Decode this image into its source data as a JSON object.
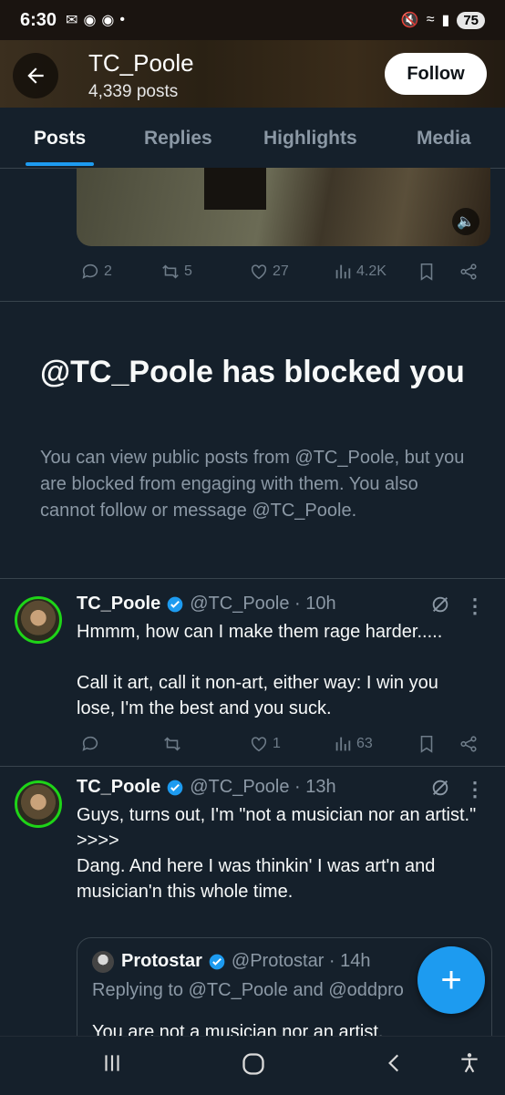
{
  "status_bar": {
    "time": "6:30",
    "battery": "75"
  },
  "header": {
    "title": "TC_Poole",
    "subtitle": "4,339 posts",
    "follow_label": "Follow"
  },
  "tabs": [
    {
      "label": "Posts"
    },
    {
      "label": "Replies"
    },
    {
      "label": "Highlights"
    },
    {
      "label": "Media"
    }
  ],
  "prev_post_actions": {
    "replies": "2",
    "reposts": "5",
    "likes": "27",
    "views": "4.2K"
  },
  "blocked": {
    "title": "@TC_Poole has blocked you",
    "text": "You can view public posts from @TC_Poole, but you are blocked from engaging with them. You also cannot follow or message @TC_Poole."
  },
  "tweets": [
    {
      "name": "TC_Poole",
      "handle": "@TC_Poole · 10h",
      "text": "Hmmm, how can I make them rage harder.....\n\nCall it art, call it non-art, either way: I win you lose, I'm the best and you suck.",
      "likes": "1",
      "views": "63"
    },
    {
      "name": "TC_Poole",
      "handle": "@TC_Poole · 13h",
      "text": "Guys, turns out, I'm \"not a musician nor an artist.\"\n>>>>\nDang. And here I was thinkin' I was art'n and musician'n this whole time."
    }
  ],
  "quote": {
    "name": "Protostar",
    "handle": "@Protostar · 14h",
    "reply_to": "Replying to @TC_Poole and @oddpro",
    "text": "You are not a musician nor an artist."
  },
  "colors": {
    "accent": "#1d9bf0",
    "background": "#15202b",
    "muted": "#8b98a5"
  }
}
